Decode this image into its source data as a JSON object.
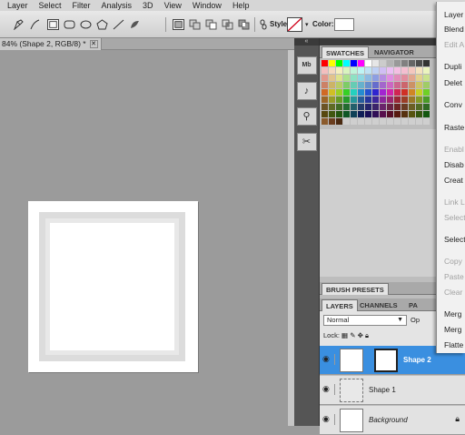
{
  "menubar": [
    "Layer",
    "Select",
    "Filter",
    "Analysis",
    "3D",
    "View",
    "Window",
    "Help"
  ],
  "options": {
    "style_label": "Style:",
    "color_label": "Color:"
  },
  "document": {
    "tab_title": "84% (Shape 2, RGB/8) *",
    "close_glyph": "✕"
  },
  "dock": {
    "collapse_glyph": "«",
    "icons": [
      "Mb",
      "♪",
      "⚲",
      "✂"
    ]
  },
  "swatches_panel": {
    "tabs": [
      "SWATCHES",
      "NAVIGATOR"
    ]
  },
  "brush_panel": {
    "tab": "BRUSH PRESETS"
  },
  "layers_panel": {
    "tabs": [
      "LAYERS",
      "CHANNELS",
      "PA"
    ],
    "blend_mode": "Normal",
    "opacity_label": "Op",
    "lock_label": "Lock:",
    "layers": [
      {
        "name": "Shape 2",
        "selected": true
      },
      {
        "name": "Shape 1",
        "selected": false
      },
      {
        "name": "Background",
        "selected": false
      }
    ]
  },
  "context_menu": {
    "items": [
      {
        "label": "Layer",
        "disabled": false
      },
      {
        "label": "Blend",
        "disabled": false
      },
      {
        "label": "Edit A",
        "disabled": true
      },
      {
        "label": "Dupli",
        "disabled": false
      },
      {
        "label": "Delet",
        "disabled": false
      },
      {
        "label": "Conv",
        "disabled": false
      },
      {
        "label": "Raste",
        "disabled": false
      },
      {
        "label": "Enabl",
        "disabled": true
      },
      {
        "label": "Disab",
        "disabled": false
      },
      {
        "label": "Creat",
        "disabled": false
      },
      {
        "label": "Link L",
        "disabled": true
      },
      {
        "label": "Select",
        "disabled": true
      },
      {
        "label": "Select",
        "disabled": false
      },
      {
        "label": "Copy",
        "disabled": true
      },
      {
        "label": "Paste",
        "disabled": true
      },
      {
        "label": "Clear",
        "disabled": true
      },
      {
        "label": "Merg",
        "disabled": false
      },
      {
        "label": "Merg",
        "disabled": false
      },
      {
        "label": "Flatte",
        "disabled": false
      }
    ]
  },
  "colors": {
    "accent": "#3a8fe0",
    "panel_dark": "#3a3a3a",
    "canvas": "#9b9b9b"
  }
}
